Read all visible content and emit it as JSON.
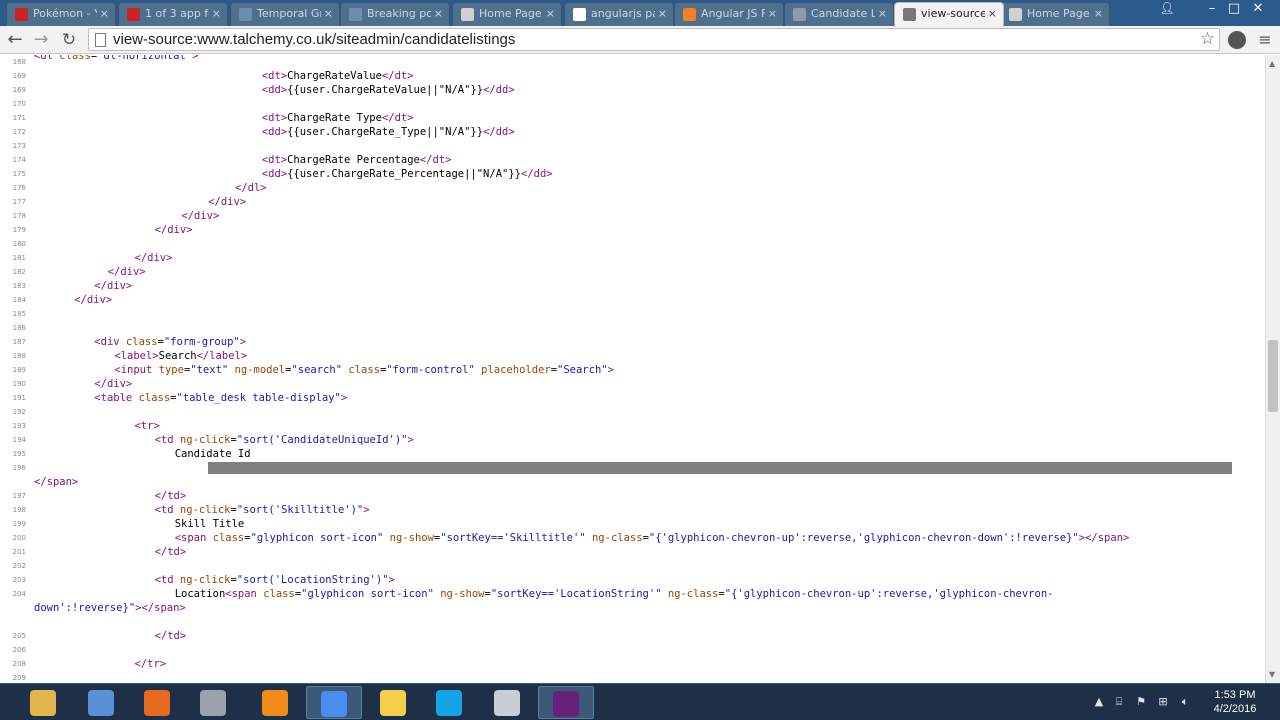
{
  "browser": {
    "tabs": [
      {
        "label": "Pokémon - Y...",
        "icon": "youtube-icon",
        "color": "#cc2222",
        "active": false
      },
      {
        "label": "1 of 3 app fo...",
        "icon": "youtube-icon",
        "color": "#cc2222",
        "active": false
      },
      {
        "label": "Temporal Gr...",
        "icon": "image-icon",
        "color": "#6b8fb3",
        "active": false
      },
      {
        "label": "Breaking po...",
        "icon": "image-icon",
        "color": "#6b8fb3",
        "active": false
      },
      {
        "label": "Home Page",
        "icon": "page-icon",
        "color": "#d0d0d0",
        "active": false
      },
      {
        "label": "angularjs pa...",
        "icon": "google-icon",
        "color": "#ffffff",
        "active": false
      },
      {
        "label": "Angular JS F...",
        "icon": "stackoverflow-icon",
        "color": "#f48024",
        "active": false
      },
      {
        "label": "Candidate L...",
        "icon": "globe-icon",
        "color": "#8a9bb0",
        "active": false
      },
      {
        "label": "view-source",
        "icon": "globe-icon",
        "color": "#777777",
        "active": true
      },
      {
        "label": "Home Page",
        "icon": "page-icon",
        "color": "#d0d0d0",
        "active": false
      }
    ],
    "close_glyph": "×",
    "url": "view-source:www.talchemy.co.uk/siteadmin/candidatelistings",
    "window_controls": {
      "minimize": "–",
      "maximize": "□",
      "close": "✕"
    }
  },
  "source_lines": [
    {
      "n": "168",
      "ind": 0,
      "html": "<span class=\"tag\">&lt;dl</span> <span class=\"attr\">class</span>=<span class=\"val\">\"dl-horizontal\"</span><span class=\"tag\">&gt;</span>",
      "partial": true
    },
    {
      "n": "169",
      "ind": 34,
      "html": "<span class=\"tag\">&lt;dt&gt;</span>ChargeRateValue<span class=\"tag\">&lt;/dt&gt;</span>"
    },
    {
      "n": "169",
      "ind": 34,
      "html": "<span class=\"tag\">&lt;dd&gt;</span>{{user.ChargeRateValue||\"N/A\"}}<span class=\"tag\">&lt;/dd&gt;</span>"
    },
    {
      "n": "170",
      "ind": 0,
      "html": ""
    },
    {
      "n": "171",
      "ind": 34,
      "html": "<span class=\"tag\">&lt;dt&gt;</span>ChargeRate Type<span class=\"tag\">&lt;/dt&gt;</span>"
    },
    {
      "n": "172",
      "ind": 34,
      "html": "<span class=\"tag\">&lt;dd&gt;</span>{{user.ChargeRate_Type||\"N/A\"}}<span class=\"tag\">&lt;/dd&gt;</span>"
    },
    {
      "n": "173",
      "ind": 0,
      "html": ""
    },
    {
      "n": "174",
      "ind": 34,
      "html": "<span class=\"tag\">&lt;dt&gt;</span>ChargeRate Percentage<span class=\"tag\">&lt;/dt&gt;</span>"
    },
    {
      "n": "175",
      "ind": 34,
      "html": "<span class=\"tag\">&lt;dd&gt;</span>{{user.ChargeRate_Percentage||\"N/A\"}}<span class=\"tag\">&lt;/dd&gt;</span>"
    },
    {
      "n": "176",
      "ind": 30,
      "html": "<span class=\"tag\">&lt;/dl&gt;</span>"
    },
    {
      "n": "177",
      "ind": 26,
      "html": "<span class=\"tag\">&lt;/div&gt;</span>"
    },
    {
      "n": "178",
      "ind": 22,
      "html": "<span class=\"tag\">&lt;/div&gt;</span>"
    },
    {
      "n": "179",
      "ind": 18,
      "html": "<span class=\"tag\">&lt;/div&gt;</span>"
    },
    {
      "n": "180",
      "ind": 0,
      "html": ""
    },
    {
      "n": "181",
      "ind": 15,
      "html": "<span class=\"tag\">&lt;/div&gt;</span>"
    },
    {
      "n": "182",
      "ind": 11,
      "html": "<span class=\"tag\">&lt;/div&gt;</span>"
    },
    {
      "n": "183",
      "ind": 9,
      "html": "<span class=\"tag\">&lt;/div&gt;</span>"
    },
    {
      "n": "184",
      "ind": 6,
      "html": "<span class=\"tag\">&lt;/div&gt;</span>"
    },
    {
      "n": "185",
      "ind": 0,
      "html": ""
    },
    {
      "n": "186",
      "ind": 0,
      "html": ""
    },
    {
      "n": "187",
      "ind": 9,
      "html": "<span class=\"tag\">&lt;div</span> <span class=\"attr\">class</span>=<span class=\"val\">\"form-group\"</span><span class=\"tag\">&gt;</span>"
    },
    {
      "n": "188",
      "ind": 12,
      "html": "<span class=\"tag\">&lt;label&gt;</span>Search<span class=\"tag\">&lt;/label&gt;</span>"
    },
    {
      "n": "189",
      "ind": 12,
      "html": "<span class=\"tag\">&lt;input</span> <span class=\"attr\">type</span>=<span class=\"val\">\"text\"</span> <span class=\"attr\">ng-model</span>=<span class=\"val\">\"search\"</span> <span class=\"attr\">class</span>=<span class=\"val\">\"form-control\"</span> <span class=\"attr\">placeholder</span>=<span class=\"val\">\"Search\"</span><span class=\"tag\">&gt;</span>"
    },
    {
      "n": "190",
      "ind": 9,
      "html": "<span class=\"tag\">&lt;/div&gt;</span>"
    },
    {
      "n": "191",
      "ind": 9,
      "html": "<span class=\"tag\">&lt;table</span> <span class=\"attr\">class</span>=<span class=\"val\">\"table_desk table-display\"</span><span class=\"tag\">&gt;</span>"
    },
    {
      "n": "192",
      "ind": 0,
      "html": ""
    },
    {
      "n": "193",
      "ind": 15,
      "html": "<span class=\"tag\">&lt;tr&gt;</span>"
    },
    {
      "n": "194",
      "ind": 18,
      "html": "<span class=\"tag\">&lt;td</span> <span class=\"attr\">ng-click</span>=<span class=\"val\">\"sort('CandidateUniqueId')\"</span><span class=\"tag\">&gt;</span>"
    },
    {
      "n": "195",
      "ind": 21,
      "html": "Candidate Id"
    },
    {
      "n": "196",
      "ind": 0,
      "html": "",
      "highlight": true
    },
    {
      "n": "",
      "ind": 0,
      "html": "<span class=\"tag\">&lt;/span&gt;</span>"
    },
    {
      "n": "197",
      "ind": 18,
      "html": "<span class=\"tag\">&lt;/td&gt;</span>"
    },
    {
      "n": "198",
      "ind": 18,
      "html": "<span class=\"tag\">&lt;td</span> <span class=\"attr\">ng-click</span>=<span class=\"val\">\"sort('Skilltitle')\"</span><span class=\"tag\">&gt;</span>"
    },
    {
      "n": "199",
      "ind": 21,
      "html": "Skill Title"
    },
    {
      "n": "200",
      "ind": 21,
      "html": "<span class=\"tag\">&lt;span</span> <span class=\"attr\">class</span>=<span class=\"val\">\"glyphicon sort-icon\"</span> <span class=\"attr\">ng-show</span>=<span class=\"val\">\"sortKey=='Skilltitle'\"</span> <span class=\"attr\">ng-class</span>=<span class=\"val\">\"{'glyphicon-chevron-up':reverse,'glyphicon-chevron-down':!reverse}\"</span><span class=\"tag\">&gt;&lt;/span&gt;</span>"
    },
    {
      "n": "201",
      "ind": 18,
      "html": "<span class=\"tag\">&lt;/td&gt;</span>"
    },
    {
      "n": "202",
      "ind": 0,
      "html": ""
    },
    {
      "n": "203",
      "ind": 18,
      "html": "<span class=\"tag\">&lt;td</span> <span class=\"attr\">ng-click</span>=<span class=\"val\">\"sort('LocationString')\"</span><span class=\"tag\">&gt;</span>"
    },
    {
      "n": "204",
      "ind": 21,
      "html": "Location<span class=\"tag\">&lt;span</span> <span class=\"attr\">class</span>=<span class=\"val\">\"glyphicon sort-icon\"</span> <span class=\"attr\">ng-show</span>=<span class=\"val\">\"sortKey=='LocationString'\"</span> <span class=\"attr\">ng-class</span>=<span class=\"val\">\"{'glyphicon-chevron-up':reverse,'glyphicon-chevron-</span>"
    },
    {
      "n": "",
      "ind": 0,
      "html": "<span class=\"val\">down':!reverse}\"</span><span class=\"tag\">&gt;&lt;/span&gt;</span>"
    },
    {
      "n": "",
      "ind": 0,
      "html": ""
    },
    {
      "n": "205",
      "ind": 18,
      "html": "<span class=\"tag\">&lt;/td&gt;</span>"
    },
    {
      "n": "206",
      "ind": 0,
      "html": ""
    },
    {
      "n": "208",
      "ind": 15,
      "html": "<span class=\"tag\">&lt;/tr&gt;</span>"
    },
    {
      "n": "209",
      "ind": 0,
      "html": ""
    }
  ],
  "taskbar": {
    "apps": [
      {
        "name": "explorer-taskbar-button",
        "icon": "folder-icon",
        "color": "#e2b64a",
        "running": false
      },
      {
        "name": "paint-taskbar-button",
        "icon": "paint-icon",
        "color": "#5b8fd8",
        "running": false
      },
      {
        "name": "firefox-taskbar-button",
        "icon": "firefox-icon",
        "color": "#e66a1e",
        "running": false
      },
      {
        "name": "tool-taskbar-button",
        "icon": "tools-icon",
        "color": "#9aa3ad",
        "running": false
      },
      {
        "name": "firefox-alt-taskbar-button",
        "icon": "firefox-icon",
        "color": "#f08b1a",
        "running": false
      },
      {
        "name": "chrome-taskbar-button",
        "icon": "chrome-icon",
        "color": "#4a8cf0",
        "running": true
      },
      {
        "name": "notes-taskbar-button",
        "icon": "sticky-notes-icon",
        "color": "#f5d04a",
        "running": false
      },
      {
        "name": "skype-taskbar-button",
        "icon": "skype-icon",
        "color": "#12a5e6",
        "running": false
      },
      {
        "name": "save-taskbar-button",
        "icon": "floppy-icon",
        "color": "#c8ced6",
        "running": false
      },
      {
        "name": "visual-studio-taskbar-button",
        "icon": "visual-studio-icon",
        "color": "#68217a",
        "running": true
      }
    ],
    "time": "1:53 PM",
    "date": "4/2/2016"
  }
}
